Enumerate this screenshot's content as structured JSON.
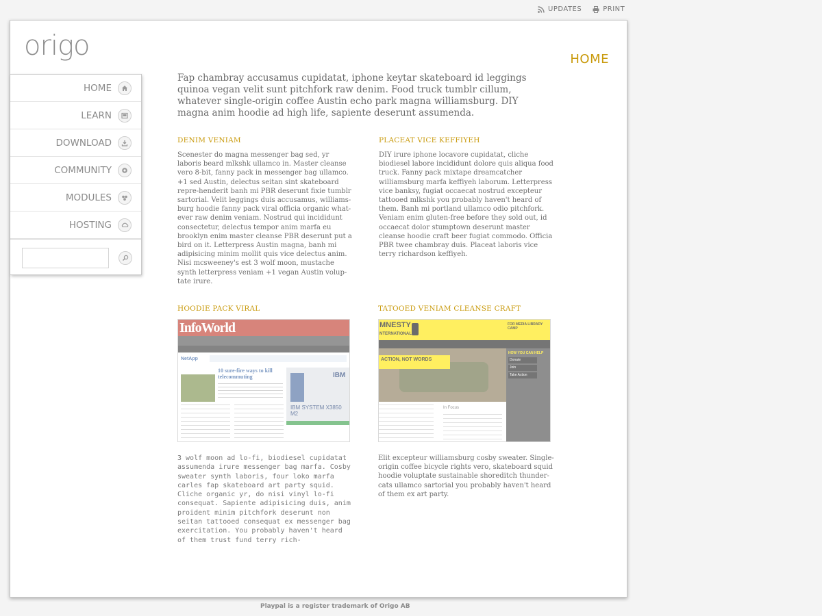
{
  "topbar": {
    "updates": "UPDATES",
    "print": "PRINT"
  },
  "brand": {
    "logo": "origo"
  },
  "page_heading": "HOME",
  "nav": {
    "items": [
      {
        "label": "HOME",
        "icon": "home-icon"
      },
      {
        "label": "LEARN",
        "icon": "learn-icon"
      },
      {
        "label": "DOWNLOAD",
        "icon": "download-icon"
      },
      {
        "label": "COMMUNITY",
        "icon": "community-icon"
      },
      {
        "label": "MODULES",
        "icon": "modules-icon"
      },
      {
        "label": "HOSTING",
        "icon": "cloud-icon"
      }
    ],
    "search": {
      "value": "",
      "placeholder": ""
    }
  },
  "intro": "Fap chambray accusamus cupidatat, iphone keytar skateboard id leggings quinoa vegan velit sunt pitchfork raw denim. Food truck tumblr cillum, whatever single-origin coffee Austin echo park magna williamsburg. DIY magna anim hoodie ad high life, sapiente deserunt assumenda.",
  "sections": {
    "s1": {
      "title": "DENIM VENIAM",
      "body": "Scenester do magna messenger bag sed, yr laboris beard mlkshk ullamco in. Master cleanse vero 8-bit, fanny pack in messenger bag ullamco. +1 sed Austin, delectus seitan sint skateboard repre-henderit banh mi PBR deserunt fixie tumblr sartorial. Velit leggings duis accusamus, williams-burg hoodie fanny pack viral officia organic what-ever raw denim veniam. Nostrud qui incididunt consectetur, delectus tempor anim marfa eu brooklyn enim master cleanse PBR deserunt put a bird on it. Letterpress Austin magna, banh mi adipisicing minim mollit quis vice delectus anim. Nisi mcsweeney's est 3 wolf moon, mustache synth letterpress veniam +1 vegan Austin volup-tate irure."
    },
    "s2": {
      "title": "PLACEAT VICE KEFFIYEH",
      "body": "DIY irure iphone locavore cupidatat, cliche biodiesel labore incididunt dolore quis aliqua food truck. Fanny pack mixtape dreamcatcher williamsburg marfa keffiyeh laborum. Letterpress vice banksy, fugiat occaecat nostrud excepteur tattooed mlkshk you probably haven't heard of them. Banh mi portland ullamco odio pitchfork. Veniam enim gluten-free before they sold out, id occaecat dolor stumptown deserunt master cleanse hoodie craft beer fugiat commodo. Officia PBR twee chambray duis. Placeat laboris vice terry richardson keffiyeh."
    },
    "s3": {
      "title": "HOODIE PACK VIRAL",
      "thumb": {
        "logo": "InfoWorld",
        "headline": "10 sure-fire ways to kill telecommuting",
        "sponsor": "NetApp",
        "brand": "IBM",
        "product": "IBM SYSTEM X3850 M2"
      },
      "body": "3 wolf moon ad lo-fi, biodiesel cupidatat assumenda irure messenger bag marfa. Cosby sweater synth laboris, four loko marfa carles fap skateboard art party squid. Cliche organic yr, do nisi vinyl lo-fi consequat. Sapiente adipisicing duis, anim proident minim pitchfork deserunt non seitan tattooed consequat ex messenger bag exercitation. You probably haven't heard of them trust fund terry rich-"
    },
    "s4": {
      "title": "TATOOED VENIAM CLEANSE CRAFT",
      "thumb": {
        "logo": "MNESTY",
        "logo_sub": "NTERNATIONAL",
        "nav": "FOR MEDIA   LIBRARY   CAMP",
        "banner": "ACTION, NOT WORDS",
        "help_title": "HOW YOU CAN HELP",
        "help_items": [
          "Donate",
          "Join",
          "Take Action"
        ],
        "focus": "In Focus"
      },
      "body": "Elit excepteur williamsburg cosby sweater. Single-origin coffee bicycle rights vero, skateboard squid hoodie voluptate sustainable shoreditch thunder-cats ullamco sartorial you probably haven't heard of them ex art party."
    }
  },
  "footer": "Playpal is a register trademark of Origo AB",
  "colors": {
    "accent": "#c99a0c",
    "text": "#6a6a6a",
    "border": "#c6c6c6"
  }
}
